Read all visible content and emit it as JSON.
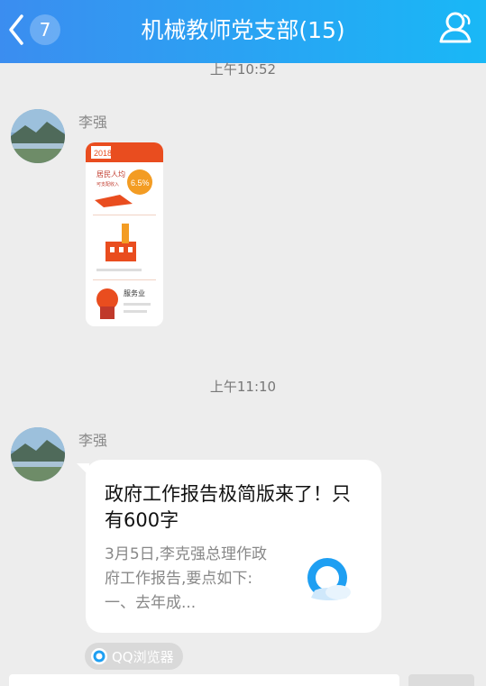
{
  "header": {
    "back_badge": "7",
    "title": "机械教师党支部(15)",
    "colors": {
      "start": "#3b8df0",
      "end": "#19b8f6"
    }
  },
  "timestamps": [
    "上午10:52",
    "上午11:10"
  ],
  "messages": [
    {
      "sender": "李强",
      "type": "image",
      "image_texts": [
        "2018",
        "居民人均",
        "可支配收入",
        "6.5%",
        "服务业"
      ]
    },
    {
      "sender": "李强",
      "type": "link-card",
      "title": "政府工作报告极简版来了！只有600字",
      "description": "3月5日,李克强总理作政府工作报告,要点如下:一、去年成...",
      "source": "QQ浏览器"
    }
  ],
  "icons": [
    "back-chevron-icon",
    "contacts-icon",
    "qq-browser-icon"
  ]
}
